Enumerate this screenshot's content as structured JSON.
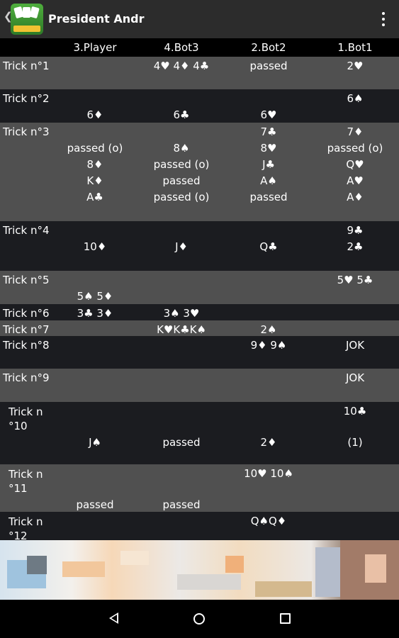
{
  "app": {
    "title": "President Andr"
  },
  "columns": [
    "3.Player",
    "4.Bot3",
    "2.Bot2",
    "1.Bot1"
  ],
  "tricks": [
    {
      "label": "Trick n°1",
      "lines": [
        [
          "",
          "4♥  4♦  4♣",
          "passed",
          "2♥"
        ]
      ]
    },
    {
      "label": "Trick n°2",
      "lines": [
        [
          "",
          "",
          "",
          "6♠"
        ],
        [
          "6♦",
          "6♣",
          "6♥",
          ""
        ]
      ]
    },
    {
      "label": "Trick n°3",
      "lines": [
        [
          "",
          "",
          "7♣",
          "7♦"
        ],
        [
          "passed (o)",
          "8♠",
          "8♥",
          "passed (o)"
        ],
        [
          "8♦",
          "passed (o)",
          "J♣",
          "Q♥"
        ],
        [
          "K♦",
          "passed",
          "A♠",
          "A♥"
        ],
        [
          "A♣",
          "passed (o)",
          "passed",
          "A♦"
        ]
      ]
    },
    {
      "label": "Trick n°4",
      "lines": [
        [
          "",
          "",
          "",
          "9♣"
        ],
        [
          "10♦",
          "J♦",
          "Q♣",
          "2♣"
        ]
      ]
    },
    {
      "label": "Trick n°5",
      "lines": [
        [
          "",
          "",
          "",
          "5♥  5♣"
        ],
        [
          "5♠  5♦",
          "",
          "",
          ""
        ]
      ]
    },
    {
      "label": "Trick n°6",
      "lines": [
        [
          "3♣  3♦",
          "3♠  3♥",
          "",
          ""
        ]
      ]
    },
    {
      "label": "Trick n°7",
      "lines": [
        [
          "",
          "K♥K♣K♠",
          "2♠",
          ""
        ]
      ]
    },
    {
      "label": "Trick n°8",
      "lines": [
        [
          "",
          "",
          "9♦  9♠",
          "JOK"
        ]
      ]
    },
    {
      "label": "Trick n°9",
      "lines": [
        [
          "",
          "",
          "",
          "JOK"
        ]
      ]
    },
    {
      "label": "Trick n °10",
      "lines": [
        [
          "",
          "",
          "",
          "10♣"
        ],
        [
          "J♠",
          "passed",
          "2♦",
          "(1)"
        ]
      ]
    },
    {
      "label": "Trick n °11",
      "lines": [
        [
          "",
          "",
          "10♥ 10♠",
          ""
        ],
        [
          "passed",
          "passed",
          "",
          ""
        ]
      ]
    },
    {
      "label": "Trick n °12",
      "lines": [
        [
          "",
          "",
          "Q♠Q♦",
          ""
        ]
      ]
    }
  ],
  "icons": {
    "back": "chevron-left-icon",
    "menu": "overflow-menu-icon",
    "nav_back": "back-triangle-icon",
    "nav_home": "home-circle-icon",
    "nav_recent": "recents-square-icon"
  },
  "colors": {
    "appbar": "#2c2c2c",
    "row_light": "#505050",
    "row_dark": "#1b1c20",
    "header": "#000000"
  }
}
